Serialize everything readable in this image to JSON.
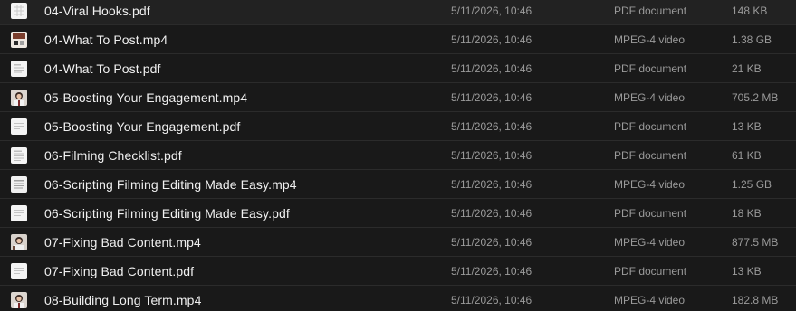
{
  "files": [
    {
      "name": "04-Viral Hooks.pdf",
      "date": "5/11/2026, 10:46",
      "kind": "PDF document",
      "size": "148 KB",
      "icon": "pdf-grid-icon"
    },
    {
      "name": "04-What To Post.mp4",
      "date": "5/11/2026, 10:46",
      "kind": "MPEG-4 video",
      "size": "1.38 GB",
      "icon": "video-thumbnail-icon"
    },
    {
      "name": "04-What To Post.pdf",
      "date": "5/11/2026, 10:46",
      "kind": "PDF document",
      "size": "21 KB",
      "icon": "pdf-page-icon"
    },
    {
      "name": "05-Boosting Your Engagement.mp4",
      "date": "5/11/2026, 10:46",
      "kind": "MPEG-4 video",
      "size": "705.2 MB",
      "icon": "video-portrait-icon"
    },
    {
      "name": "05-Boosting Your Engagement.pdf",
      "date": "5/11/2026, 10:46",
      "kind": "PDF document",
      "size": "13 KB",
      "icon": "pdf-page-icon"
    },
    {
      "name": "06-Filming Checklist.pdf",
      "date": "5/11/2026, 10:46",
      "kind": "PDF document",
      "size": "61 KB",
      "icon": "pdf-page-icon"
    },
    {
      "name": "06-Scripting Filming Editing Made Easy.mp4",
      "date": "5/11/2026, 10:46",
      "kind": "MPEG-4 video",
      "size": "1.25 GB",
      "icon": "video-slide-icon"
    },
    {
      "name": "06-Scripting Filming Editing Made Easy.pdf",
      "date": "5/11/2026, 10:46",
      "kind": "PDF document",
      "size": "18 KB",
      "icon": "pdf-page-icon"
    },
    {
      "name": "07-Fixing Bad Content.mp4",
      "date": "5/11/2026, 10:46",
      "kind": "MPEG-4 video",
      "size": "877.5 MB",
      "icon": "video-portrait-icon"
    },
    {
      "name": "07-Fixing Bad Content.pdf",
      "date": "5/11/2026, 10:46",
      "kind": "PDF document",
      "size": "13 KB",
      "icon": "pdf-page-icon"
    },
    {
      "name": "08-Building Long Term.mp4",
      "date": "5/11/2026, 10:46",
      "kind": "MPEG-4 video",
      "size": "182.8 MB",
      "icon": "video-portrait-icon"
    }
  ]
}
